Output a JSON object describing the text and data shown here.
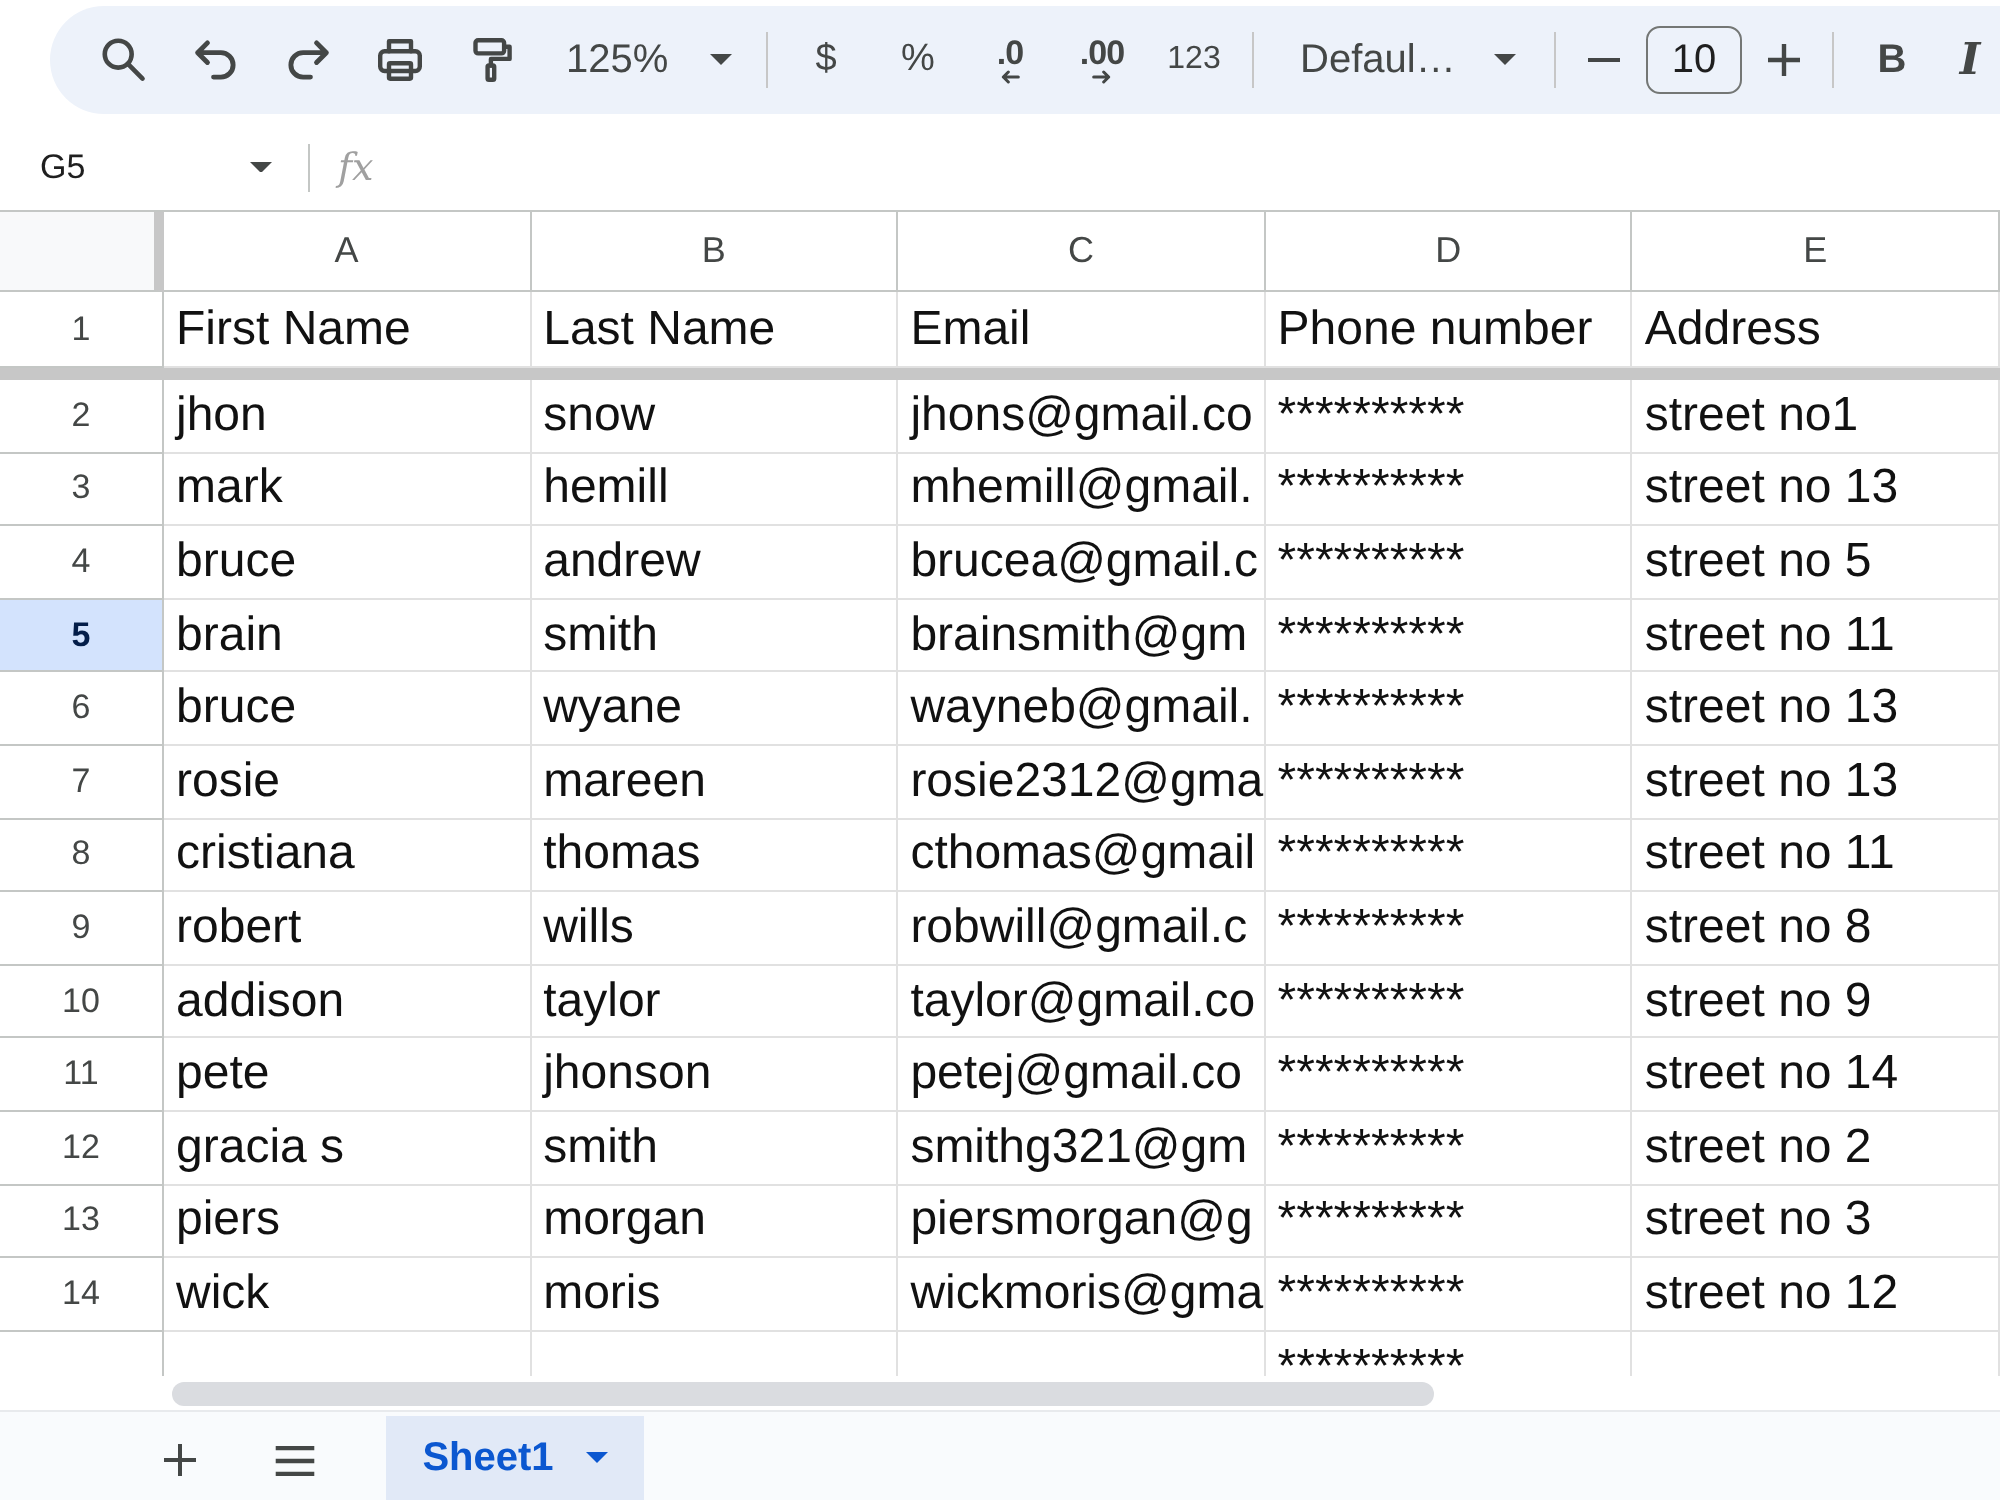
{
  "toolbar": {
    "zoom": "125%",
    "currency": "$",
    "percent": "%",
    "decrease_decimals": ".0",
    "increase_decimals": ".00",
    "number_format": "123",
    "font": "Defaul…",
    "font_size": "10",
    "bold": "B",
    "italic": "I"
  },
  "formula_bar": {
    "name_box": "G5",
    "function_label": "fx"
  },
  "columns": [
    "A",
    "B",
    "C",
    "D",
    "E"
  ],
  "rows": [
    {
      "number": "1",
      "selected": false,
      "frozen": true,
      "cells": [
        "First Name",
        "Last Name",
        "Email",
        "Phone number",
        "Address"
      ]
    },
    {
      "number": "2",
      "selected": false,
      "frozen": false,
      "cells": [
        "jhon",
        "snow",
        "jhons@gmail.co",
        "**********",
        "street no1"
      ]
    },
    {
      "number": "3",
      "selected": false,
      "frozen": false,
      "cells": [
        "mark",
        "hemill",
        "mhemill@gmail.",
        "**********",
        "street no 13"
      ]
    },
    {
      "number": "4",
      "selected": false,
      "frozen": false,
      "cells": [
        "bruce",
        "andrew",
        "brucea@gmail.c",
        "**********",
        "street no 5"
      ]
    },
    {
      "number": "5",
      "selected": true,
      "frozen": false,
      "cells": [
        "brain",
        "smith",
        "brainsmith@gm",
        "**********",
        "street no 11"
      ]
    },
    {
      "number": "6",
      "selected": false,
      "frozen": false,
      "cells": [
        "bruce",
        "wyane",
        "wayneb@gmail.",
        "**********",
        "street no 13"
      ]
    },
    {
      "number": "7",
      "selected": false,
      "frozen": false,
      "cells": [
        "rosie",
        "mareen",
        "rosie2312@gma",
        "**********",
        "street no 13"
      ]
    },
    {
      "number": "8",
      "selected": false,
      "frozen": false,
      "cells": [
        "cristiana",
        "thomas",
        "cthomas@gmail",
        "**********",
        "street no 11"
      ]
    },
    {
      "number": "9",
      "selected": false,
      "frozen": false,
      "cells": [
        "robert",
        "wills",
        "robwill@gmail.c",
        "**********",
        "street no 8"
      ]
    },
    {
      "number": "10",
      "selected": false,
      "frozen": false,
      "cells": [
        "addison",
        "taylor",
        "taylor@gmail.co",
        "**********",
        "street no 9"
      ]
    },
    {
      "number": "11",
      "selected": false,
      "frozen": false,
      "cells": [
        "pete",
        "jhonson",
        "petej@gmail.co",
        "**********",
        "street no 14"
      ]
    },
    {
      "number": "12",
      "selected": false,
      "frozen": false,
      "cells": [
        "gracia s",
        "smith",
        "smithg321@gm",
        "**********",
        "street no 2"
      ]
    },
    {
      "number": "13",
      "selected": false,
      "frozen": false,
      "cells": [
        "piers",
        "morgan",
        "piersmorgan@g",
        "**********",
        "street no 3"
      ]
    },
    {
      "number": "14",
      "selected": false,
      "frozen": false,
      "cells": [
        "wick",
        "moris",
        "wickmoris@gma",
        "**********",
        "street no 12"
      ]
    },
    {
      "selected": false,
      "frozen": false,
      "cells": [
        null,
        null,
        null,
        "**********",
        null
      ]
    }
  ],
  "sheet_tabs": [
    {
      "label": "Sheet1",
      "selected": true
    }
  ]
}
